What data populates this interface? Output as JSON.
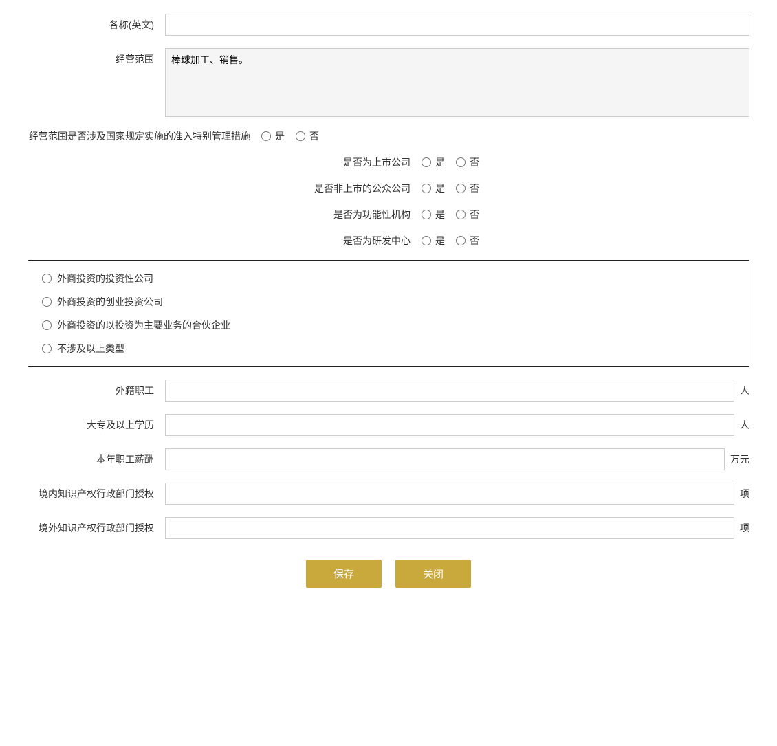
{
  "form": {
    "name_en_label": "各称(英文)",
    "name_en_value": "",
    "business_scope_label": "经营范围",
    "business_scope_value": "棒球加工、销售。",
    "special_mgmt_label": "经营范围是否涉及国家规定实施的准入特别管理措施",
    "is_listed_label": "是否为上市公司",
    "is_public_non_listed_label": "是否非上市的公众公司",
    "is_functional_org_label": "是否为功能性机构",
    "is_rd_center_label": "是否为研发中心",
    "yes_label": "是",
    "no_label": "否",
    "foreign_investment_types": [
      "外商投资的投资性公司",
      "外商投资的创业投资公司",
      "外商投资的以投资为主要业务的合伙企业",
      "不涉及以上类型"
    ],
    "foreign_staff_label": "外籍职工",
    "foreign_staff_value": "",
    "foreign_staff_unit": "人",
    "college_edu_label": "大专及以上学历",
    "college_edu_value": "",
    "college_edu_unit": "人",
    "annual_salary_label": "本年职工薪酬",
    "annual_salary_value": "",
    "annual_salary_unit": "万元",
    "domestic_ip_label": "境内知识产权行政部门授权",
    "domestic_ip_value": "",
    "domestic_ip_unit": "项",
    "overseas_ip_label": "境外知识产权行政部门授权",
    "overseas_ip_value": "",
    "overseas_ip_unit": "项",
    "save_button": "保存",
    "close_button": "关闭"
  }
}
